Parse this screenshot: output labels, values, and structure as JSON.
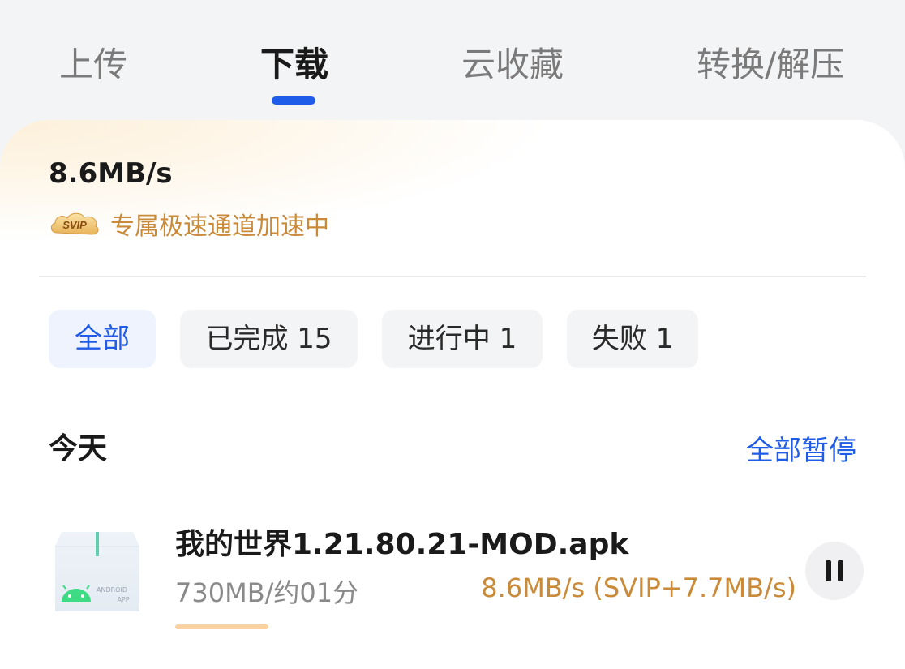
{
  "tabs": {
    "upload": "上传",
    "download": "下载",
    "cloud_collect": "云收藏",
    "convert_unzip": "转换/解压"
  },
  "speed_panel": {
    "current_speed": "8.6MB/s",
    "svip_badge_text": "SVIP",
    "svip_message": "专属极速通道加速中"
  },
  "filters": {
    "all": "全部",
    "completed": "已完成 15",
    "in_progress": "进行中 1",
    "failed": "失败 1"
  },
  "section": {
    "title": "今天",
    "pause_all": "全部暂停"
  },
  "download_item": {
    "file_name": "我的世界1.21.80.21-MOD.apk",
    "size_and_eta": "730MB/约01分",
    "speed_detail": "8.6MB/s (SVIP+7.7MB/s)",
    "icon_label_line1": "ANDROID",
    "icon_label_line2": "APP",
    "progress_fraction": 0.15
  },
  "colors": {
    "accent_blue": "#1f5ce8",
    "svip_gold": "#c98a3a",
    "progress_fill": "#f8d2a3",
    "android_green": "#3ddc84"
  }
}
